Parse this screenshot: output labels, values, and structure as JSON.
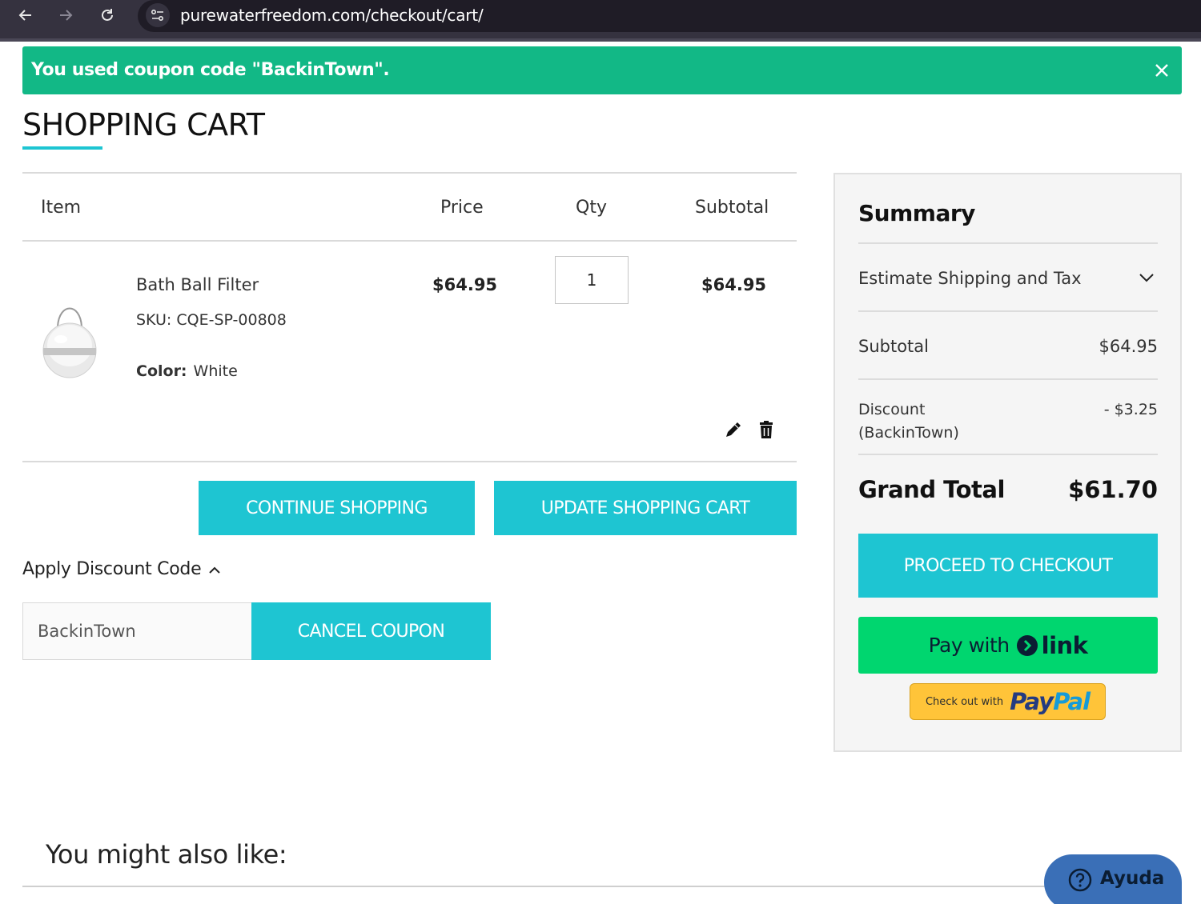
{
  "browser": {
    "url": "purewaterfreedom.com/checkout/cart/",
    "icons": [
      "back-arrow-icon",
      "forward-arrow-icon",
      "reload-icon",
      "site-info-icon"
    ]
  },
  "notice": {
    "message": "You used coupon code \"BackinTown\".",
    "color": "#12b886"
  },
  "page": {
    "title": "SHOPPING CART",
    "accent_color": "#1ec5d2"
  },
  "cart": {
    "headers": {
      "item": "Item",
      "price": "Price",
      "qty": "Qty",
      "subtotal": "Subtotal"
    },
    "items": [
      {
        "name": "Bath Ball Filter",
        "sku": "SKU: CQE-SP-00808",
        "color_label": "Color:",
        "color_value": "White",
        "price": "$64.95",
        "qty": "1",
        "subtotal": "$64.95"
      }
    ],
    "continue_label": "CONTINUE SHOPPING",
    "update_label": "UPDATE SHOPPING CART"
  },
  "discount": {
    "toggle_label": "Apply Discount Code",
    "code_value": "BackinTown",
    "cancel_label": "CANCEL COUPON"
  },
  "summary": {
    "title": "Summary",
    "estimate_label": "Estimate Shipping and Tax",
    "subtotal_label": "Subtotal",
    "subtotal_value": "$64.95",
    "discount_label": "Discount",
    "discount_code": "(BackinTown)",
    "discount_value": "- $3.25",
    "grand_total_label": "Grand Total",
    "grand_total_value": "$61.70",
    "checkout_label": "PROCEED TO CHECKOUT",
    "link_pay_label": "Pay with",
    "link_word": "link",
    "paypal_small": "Check out with",
    "paypal_pay": "Pay",
    "paypal_pal": "Pal"
  },
  "footer": {
    "also_like": "You might also like:",
    "help_label": "Ayuda"
  }
}
